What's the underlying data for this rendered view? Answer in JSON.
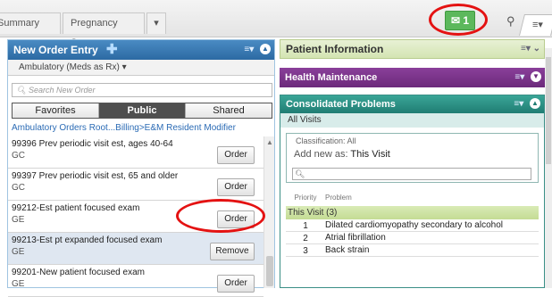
{
  "tabs": [
    "Summary",
    "Pregnancy Sum...",
    "▾"
  ],
  "notification_count": "1",
  "left_panel": {
    "title": "New Order Entry",
    "subtitle": "Ambulatory (Meds as Rx) ▾",
    "search_placeholder": "Search New Order",
    "segments": [
      "Favorites",
      "Public",
      "Shared"
    ],
    "active_segment": "Public",
    "breadcrumb": "Ambulatory Orders Root...Billing>E&M Resident Modifier",
    "orders": [
      {
        "name": "99396 Prev periodic visit est, ages 40-64",
        "code": "GC",
        "button": "Order"
      },
      {
        "name": "99397 Prev periodic visit est, 65 and older",
        "code": "GC",
        "button": "Order"
      },
      {
        "name": "99212-Est patient focused exam",
        "code": "GE",
        "button": "Order"
      },
      {
        "name": "99213-Est pt expanded focused exam",
        "code": "GE",
        "button": "Remove"
      },
      {
        "name": "99201-New patient focused exam",
        "code": "GE",
        "button": "Order"
      }
    ]
  },
  "right_panel": {
    "patient_info_title": "Patient Information",
    "health_maintenance_title": "Health Maintenance",
    "consolidated_problems": {
      "title": "Consolidated Problems",
      "filter": "All Visits",
      "classification": "Classification: All",
      "add_new_label": "Add new as:",
      "add_new_value": "This Visit",
      "col_priority": "Priority",
      "col_problem": "Problem",
      "group": "This Visit (3)",
      "problems": [
        {
          "priority": "1",
          "problem": "Dilated cardiomyopathy secondary to alcohol"
        },
        {
          "priority": "2",
          "problem": "Atrial fibrillation"
        },
        {
          "priority": "3",
          "problem": "Back strain"
        }
      ]
    }
  },
  "colors": {
    "annotation": "#e41212",
    "order_header": "#2c6aa3",
    "health_maintenance": "#6c2a7b",
    "problems_header": "#207d73"
  }
}
